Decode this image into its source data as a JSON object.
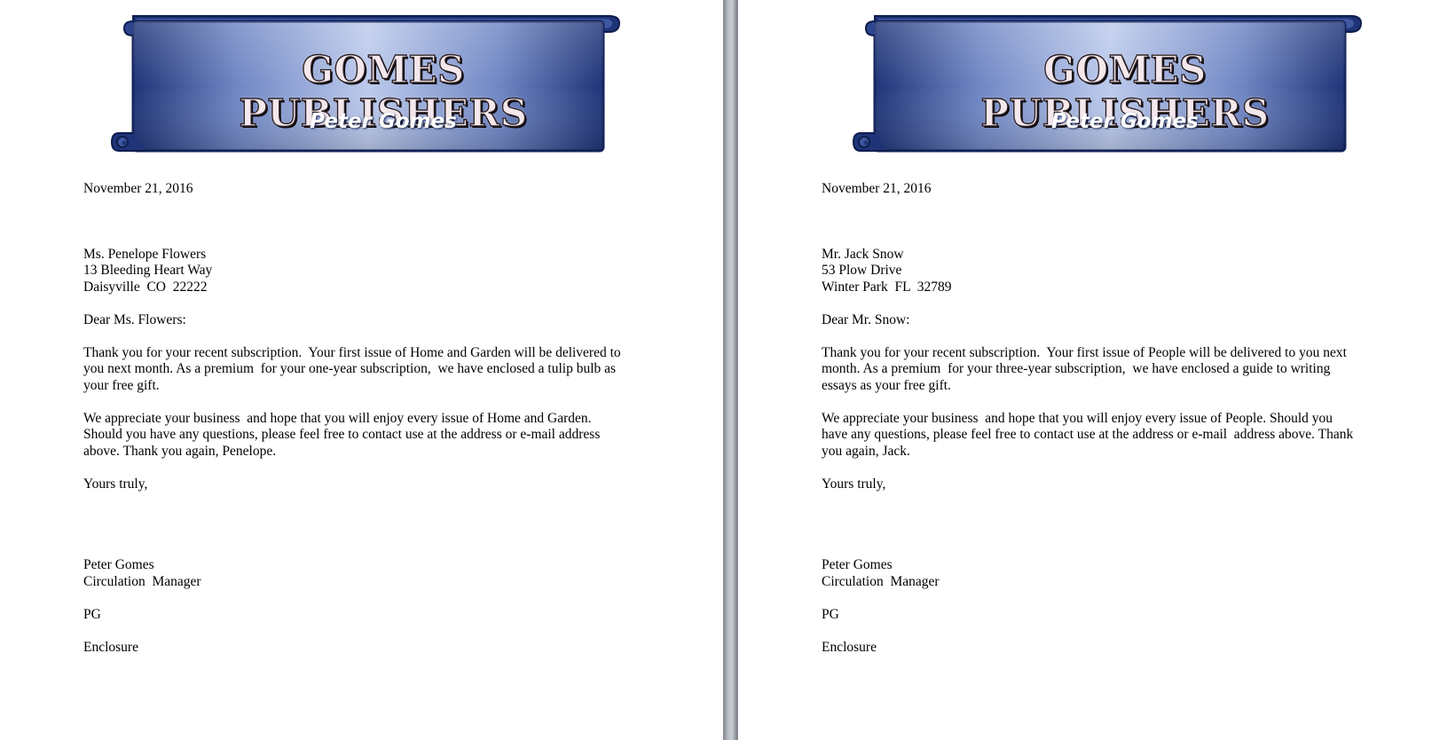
{
  "pages": [
    {
      "banner": {
        "title": "GOMES PUBLISHERS",
        "subtitle": "Peter Gomes"
      },
      "date": "November 21, 2016",
      "address": [
        "Ms. Penelope Flowers",
        "13 Bleeding Heart Way",
        "Daisyville  CO  22222"
      ],
      "salutation": "Dear Ms. Flowers:",
      "paragraph1": [
        "Thank you for your recent subscription.  Your first issue of Home and Garden will be delivered to",
        "you next month. As a premium  for your one-year subscription,  we have enclosed a tulip bulb as",
        "your free gift."
      ],
      "paragraph2": [
        "We appreciate your business  and hope that you will enjoy every issue of Home and Garden.",
        "Should you have any questions, please feel free to contact use at the address or e-mail address",
        "above. Thank you again, Penelope."
      ],
      "closing": "Yours truly,",
      "signer_name": "Peter Gomes",
      "signer_title": "Circulation  Manager",
      "initials": "PG",
      "enclosure": "Enclosure"
    },
    {
      "banner": {
        "title": "GOMES PUBLISHERS",
        "subtitle": "Peter Gomes"
      },
      "date": "November 21, 2016",
      "address": [
        "Mr. Jack Snow",
        "53 Plow Drive",
        "Winter Park  FL  32789"
      ],
      "salutation": "Dear Mr. Snow:",
      "paragraph1": [
        "Thank you for your recent subscription.  Your first issue of People will be delivered to you next",
        "month. As a premium  for your three-year subscription,  we have enclosed a guide to writing",
        "essays as your free gift."
      ],
      "paragraph2": [
        "We appreciate your business  and hope that you will enjoy every issue of People. Should you",
        "have any questions, please feel free to contact use at the address or e-mail  address above. Thank",
        "you again, Jack."
      ],
      "closing": "Yours truly,",
      "signer_name": "Peter Gomes",
      "signer_title": "Circulation  Manager",
      "initials": "PG",
      "enclosure": "Enclosure"
    }
  ],
  "colors": {
    "banner_dark": "#1f3478",
    "banner_light": "#b7c6ea",
    "page_background": "#ffffff",
    "gutter": "#a9aeb7"
  }
}
